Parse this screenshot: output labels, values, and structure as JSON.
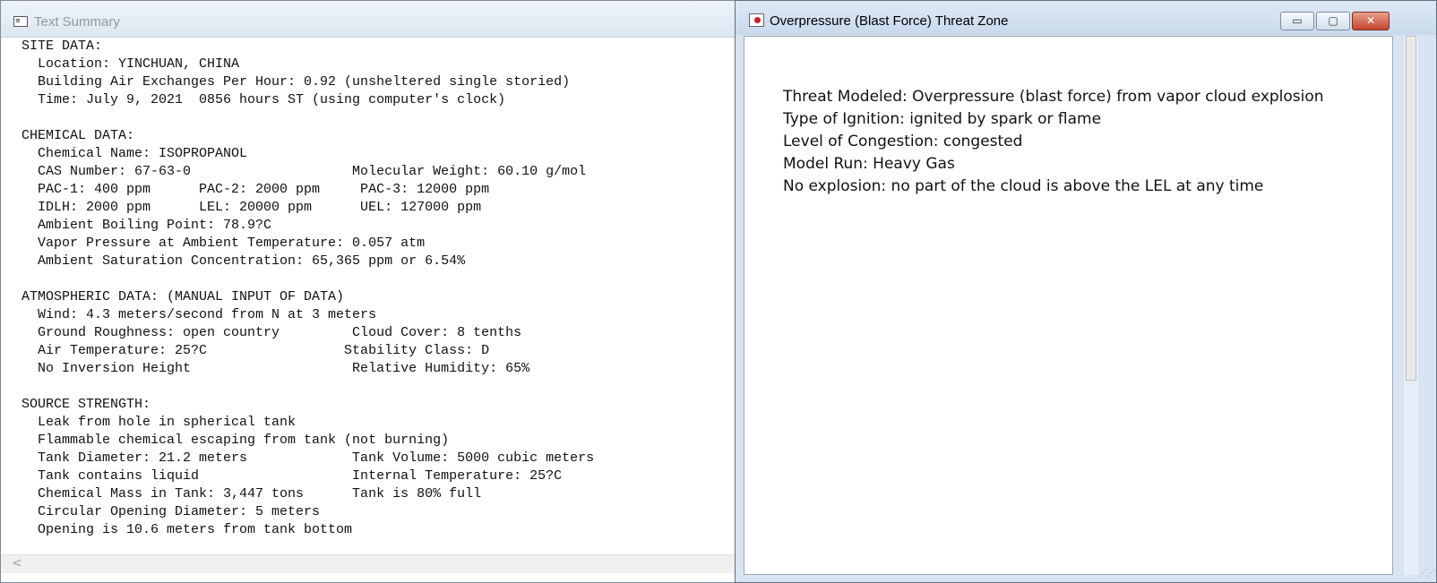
{
  "left_window": {
    "title": "Text Summary",
    "app_icon": "document-icon",
    "text": "SITE DATA:\n  Location: YINCHUAN, CHINA\n  Building Air Exchanges Per Hour: 0.92 (unsheltered single storied)\n  Time: July 9, 2021  0856 hours ST (using computer's clock)\n\nCHEMICAL DATA:\n  Chemical Name: ISOPROPANOL\n  CAS Number: 67-63-0                    Molecular Weight: 60.10 g/mol\n  PAC-1: 400 ppm      PAC-2: 2000 ppm     PAC-3: 12000 ppm\n  IDLH: 2000 ppm      LEL: 20000 ppm      UEL: 127000 ppm\n  Ambient Boiling Point: 78.9?C\n  Vapor Pressure at Ambient Temperature: 0.057 atm\n  Ambient Saturation Concentration: 65,365 ppm or 6.54%\n\nATMOSPHERIC DATA: (MANUAL INPUT OF DATA)\n  Wind: 4.3 meters/second from N at 3 meters\n  Ground Roughness: open country         Cloud Cover: 8 tenths\n  Air Temperature: 25?C                 Stability Class: D\n  No Inversion Height                    Relative Humidity: 65%\n\nSOURCE STRENGTH:\n  Leak from hole in spherical tank\n  Flammable chemical escaping from tank (not burning)\n  Tank Diameter: 21.2 meters             Tank Volume: 5000 cubic meters\n  Tank contains liquid                   Internal Temperature: 25?C\n  Chemical Mass in Tank: 3,447 tons      Tank is 80% full\n  Circular Opening Diameter: 5 meters\n  Opening is 10.6 meters from tank bottom",
    "scroll_left_arrow": "<"
  },
  "right_window": {
    "title": "Overpressure (Blast Force) Threat Zone",
    "app_icon": "threat-zone-icon",
    "buttons": {
      "minimize": "▭",
      "maximize": "▢",
      "close": "✕"
    },
    "lines": [
      "Threat Modeled: Overpressure (blast force) from vapor cloud explosion",
      "Type of Ignition: ignited by spark or flame",
      "Level of Congestion: congested",
      "Model Run: Heavy Gas",
      "No explosion: no part of the cloud is above the LEL at any time"
    ]
  }
}
